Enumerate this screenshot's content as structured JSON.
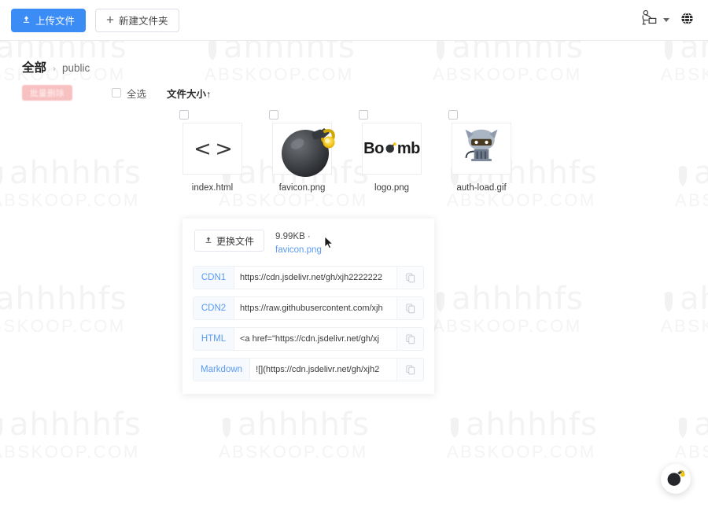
{
  "toolbar": {
    "upload_label": "上传文件",
    "upload_icon": "upload-icon",
    "new_folder_label": "新建文件夹",
    "new_folder_icon": "plus-icon",
    "avatar_icon": "user-desk-avatar-icon",
    "language_icon": "globe-icon"
  },
  "breadcrumb": {
    "root": "全部",
    "separator": "›",
    "current": "public"
  },
  "tools": {
    "bulk_delete_label": "批量删除",
    "select_all_label": "全选",
    "sort_label": "文件大小↑"
  },
  "files": [
    {
      "name": "index.html",
      "icon": "code-file-icon",
      "glyph": "< >"
    },
    {
      "name": "favicon.png",
      "icon": "bomb-image-icon",
      "glyph": ""
    },
    {
      "name": "logo.png",
      "icon": "boomb-logo-icon",
      "glyph": "Bo mb"
    },
    {
      "name": "auth-load.gif",
      "icon": "octocat-gif-icon",
      "glyph": ""
    }
  ],
  "panel": {
    "replace_label": "更换文件",
    "replace_icon": "upload-icon",
    "file_size": "9.99KB ·",
    "file_name": "favicon.png",
    "links": [
      {
        "label": "CDN1",
        "value": "https://cdn.jsdelivr.net/gh/xjh2222222",
        "copy_icon": "copy-icon"
      },
      {
        "label": "CDN2",
        "value": "https://raw.githubusercontent.com/xjh",
        "copy_icon": "copy-icon"
      },
      {
        "label": "HTML",
        "value": "<a href=\"https://cdn.jsdelivr.net/gh/xj",
        "copy_icon": "copy-icon"
      },
      {
        "label": "Markdown",
        "value": "![](https://cdn.jsdelivr.net/gh/xjh2",
        "copy_icon": "copy-icon"
      }
    ]
  },
  "fab": {
    "icon": "bomb-icon"
  },
  "watermark": {
    "main": "ahhhhfs",
    "sub": "ABSKOOP.COM"
  },
  "colors": {
    "primary": "#3b8cf5",
    "link": "#5b9bf0",
    "danger": "#f7b7b7"
  }
}
